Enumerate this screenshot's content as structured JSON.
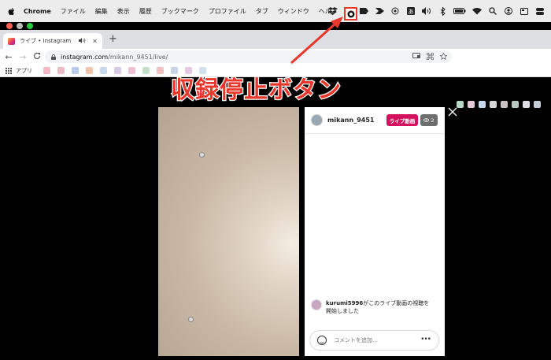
{
  "menubar": {
    "app_name": "Chrome",
    "items": [
      "ファイル",
      "編集",
      "表示",
      "履歴",
      "ブックマーク",
      "プロファイル",
      "タブ",
      "ウィンドウ",
      "ヘルプ"
    ],
    "status_icons": [
      "record-stop-icon",
      "dropbox-icon",
      "clipboard-icon",
      "tag-icon",
      "chevron-icon",
      "target-icon",
      "kana-input-icon",
      "volume-icon",
      "bluetooth-icon",
      "battery-icon",
      "wifi-icon",
      "search-icon",
      "user-icon",
      "display-icon",
      "control-center-icon"
    ]
  },
  "tab": {
    "title": "ライブ • Instagram",
    "audio_icon": "speaker-icon",
    "close_glyph": "✕"
  },
  "new_tab_glyph": "+",
  "nav": {
    "back": "←",
    "forward": "→",
    "reload": "C"
  },
  "omnibox": {
    "host": "instagram.com",
    "path": "/mikann_9451/live/"
  },
  "bookmarks": {
    "apps_label": "アプリ"
  },
  "annotation": {
    "text": "収録停止ボタン",
    "color": "#e8382d"
  },
  "live": {
    "username": "mikann_9451",
    "badge_label": "ライブ動画",
    "badge_color": "#d3115e",
    "viewer_count": "2",
    "comment": {
      "user": "kurumi5996",
      "text_line1": "がこのライブ動画の視聴を",
      "text_line2": "開始しました"
    },
    "comment_placeholder": "コメントを追加...",
    "more_glyph": "•••"
  }
}
